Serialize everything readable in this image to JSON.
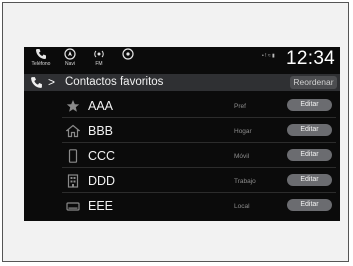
{
  "topbar": {
    "items": [
      {
        "label": "Teléfono",
        "icon": "phone-icon"
      },
      {
        "label": "Navi",
        "icon": "navigation-icon"
      },
      {
        "label": "FM",
        "icon": "radio-icon"
      },
      {
        "label": "",
        "icon": "media-icon"
      }
    ],
    "status": "• ! ≈ ▮",
    "clock": "12:34"
  },
  "header": {
    "chevron": ">",
    "title": "Contactos favoritos",
    "reorder_label": "Reordenar"
  },
  "contacts": [
    {
      "name": "AAA",
      "type": "Pref",
      "edit_label": "Editar",
      "icon": "star-icon"
    },
    {
      "name": "BBB",
      "type": "Hogar",
      "edit_label": "Editar",
      "icon": "home-icon"
    },
    {
      "name": "CCC",
      "type": "Móvil",
      "edit_label": "Editar",
      "icon": "mobile-phone-icon"
    },
    {
      "name": "DDD",
      "type": "Trabajo",
      "edit_label": "Editar",
      "icon": "building-icon"
    },
    {
      "name": "EEE",
      "type": "Local",
      "edit_label": "Editar",
      "icon": "desk-phone-icon"
    }
  ],
  "colors": {
    "screen_bg": "#0b0b0b",
    "header_bg": "#2f3033",
    "button_bg": "#6b6c70",
    "text": "#f2f2f2",
    "type_text": "#8d8d8d"
  }
}
